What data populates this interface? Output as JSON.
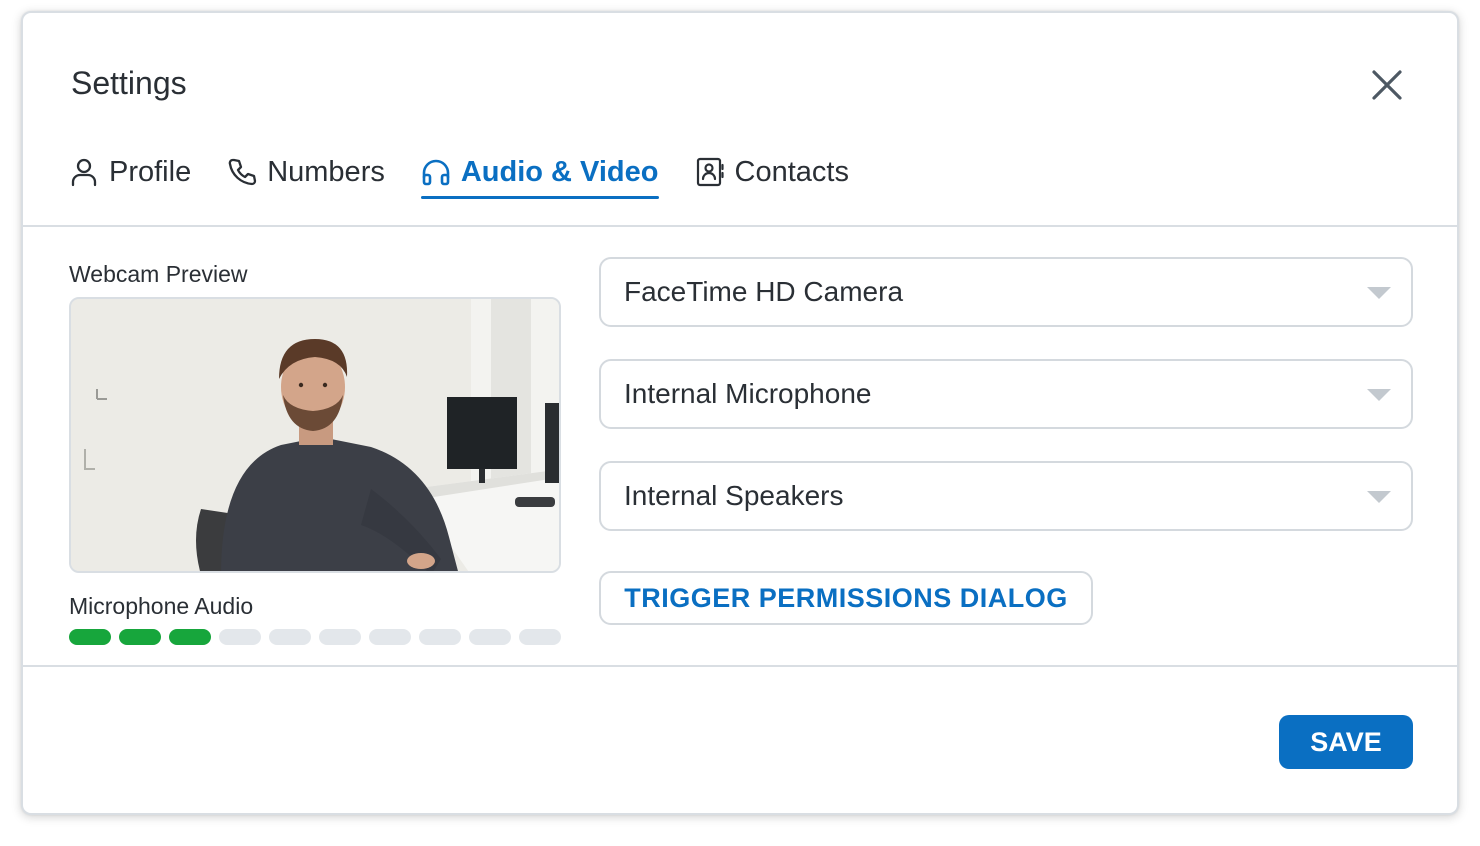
{
  "dialog": {
    "title": "Settings",
    "close_icon": "close-icon"
  },
  "tabs": [
    {
      "label": "Profile",
      "icon": "person-icon",
      "active": false
    },
    {
      "label": "Numbers",
      "icon": "phone-icon",
      "active": false
    },
    {
      "label": "Audio & Video",
      "icon": "headphones-icon",
      "active": true
    },
    {
      "label": "Contacts",
      "icon": "contact-card-icon",
      "active": false
    }
  ],
  "webcam": {
    "label": "Webcam Preview"
  },
  "microphone": {
    "label": "Microphone Audio",
    "level_segments_total": 10,
    "level_segments_active": 3,
    "active_color": "#17a63c"
  },
  "selects": {
    "camera": {
      "value": "FaceTime HD Camera"
    },
    "microphone": {
      "value": "Internal Microphone"
    },
    "speakers": {
      "value": "Internal Speakers"
    }
  },
  "buttons": {
    "permissions_label": "TRIGGER PERMISSIONS DIALOG",
    "save_label": "SAVE"
  },
  "colors": {
    "accent": "#0a6fc2",
    "border": "#d9dee3",
    "meter_on": "#17a63c",
    "meter_off": "#e3e7eb"
  }
}
